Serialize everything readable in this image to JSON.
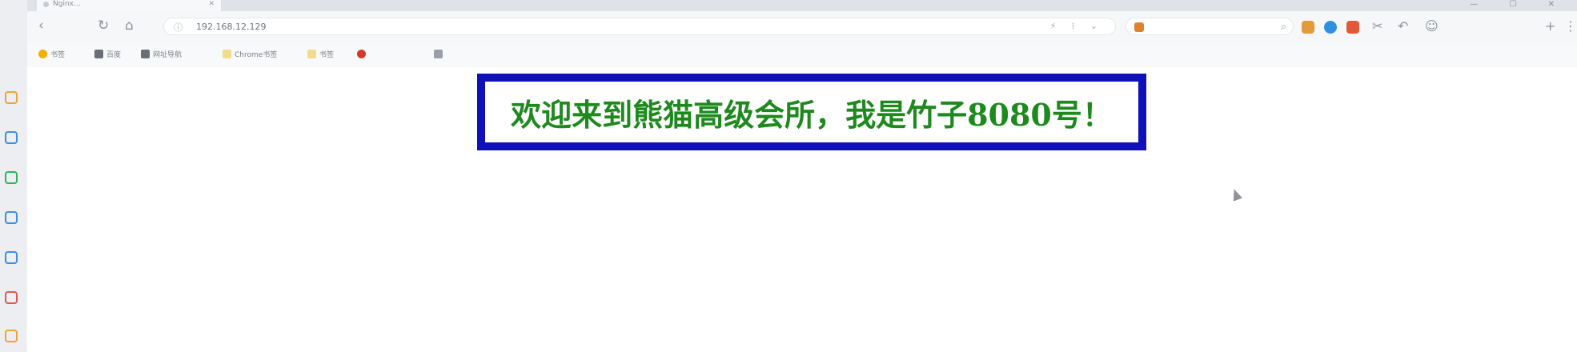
{
  "tab": {
    "title": "Nginx..."
  },
  "toolbar": {
    "back_glyph": "‹",
    "reload_glyph": "↻",
    "home_glyph": "⌂",
    "info_glyph": "ⓘ",
    "url": "192.168.12.129",
    "addr_right_glyphs": "⚡ ⁞ ⌄",
    "search_text": "",
    "search_glyph": "⌕",
    "tool_glyphs": [
      "✂",
      "↶",
      "☺",
      "+",
      "⋮"
    ]
  },
  "bookmarks": [
    {
      "label": "书签",
      "color": "#f2b100"
    },
    {
      "label": "百度",
      "color": "#6a6f75"
    },
    {
      "label": "网址导航",
      "color": "#6a6f75"
    },
    {
      "label": "Chrome书签",
      "color": "#f1dc8c"
    },
    {
      "label": "书签",
      "color": "#f1dc8c"
    },
    {
      "label": "",
      "color": "#d33a2c"
    },
    {
      "label": "",
      "color": "#9aa0a6"
    }
  ],
  "page": {
    "welcome_text": "欢迎来到熊猫高级会所，我是竹子8080号！"
  },
  "colors": {
    "box_border": "#1010b8",
    "welcome_text": "#1e8a1e"
  },
  "left_strip_colors": [
    "#f0a23a",
    "#3a8ee6",
    "#2fb35a",
    "#3a8ee6",
    "#3a8ee6",
    "#e0574f",
    "#f0a23a"
  ]
}
